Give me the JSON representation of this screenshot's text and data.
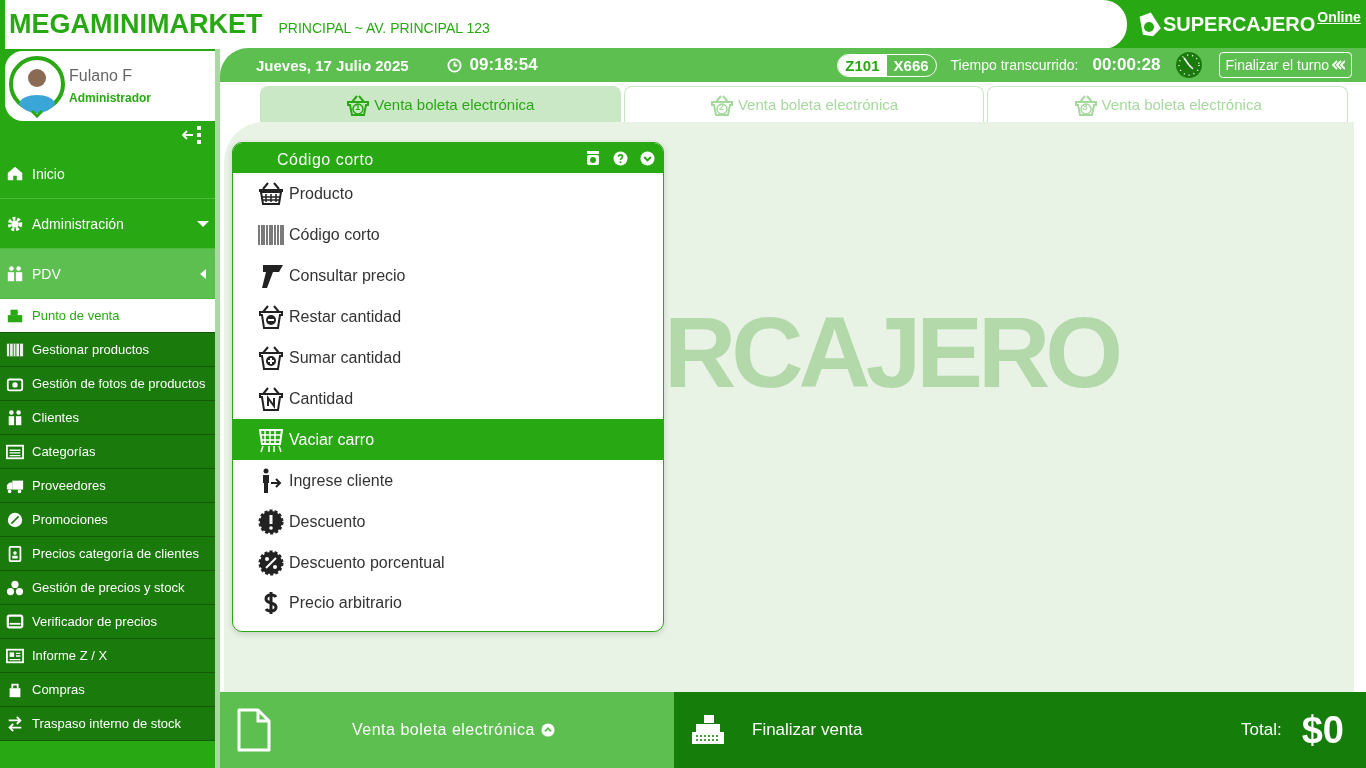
{
  "header": {
    "store_name": "MEGAMINIMARKET",
    "branch": "PRINCIPAL ~ AV. PRINCIPAL 123",
    "brand": "SUPERCAJERO",
    "brand_suffix": "Online"
  },
  "user": {
    "name": "Fulano F",
    "role": "Administrador"
  },
  "info_bar": {
    "date": "Jueves, 17 Julio 2025",
    "time": "09:18:54",
    "box_codes": [
      {
        "label": "Z101",
        "selected": true
      },
      {
        "label": "X666",
        "selected": false
      }
    ],
    "elapsed_label": "Tiempo transcurrido:",
    "elapsed": "00:00:28",
    "end_shift_button": "Finalizar el turno"
  },
  "tabs": [
    {
      "label": "Venta boleta electrónica",
      "badge": "1",
      "selected": true
    },
    {
      "label": "Venta boleta electrónica",
      "badge": "2",
      "selected": false
    },
    {
      "label": "Venta boleta electrónica",
      "badge": "3",
      "selected": false
    }
  ],
  "sidebar": {
    "items": [
      {
        "label": "Inicio",
        "expanded": false,
        "has_caret": false
      },
      {
        "label": "Administración",
        "expanded": false,
        "has_caret": true
      },
      {
        "label": "PDV",
        "expanded": true,
        "has_caret": true,
        "children": [
          {
            "label": "Punto de venta",
            "selected": true
          },
          {
            "label": "Gestionar productos",
            "selected": false
          },
          {
            "label": "Gestión de fotos de productos",
            "selected": false
          },
          {
            "label": "Clientes",
            "selected": false
          },
          {
            "label": "Categorías",
            "selected": false
          },
          {
            "label": "Proveedores",
            "selected": false
          },
          {
            "label": "Promociones",
            "selected": false
          },
          {
            "label": "Precios categoría de clientes",
            "selected": false
          },
          {
            "label": "Gestión de precios y stock",
            "selected": false
          },
          {
            "label": "Verificador de precios",
            "selected": false
          },
          {
            "label": "Informe Z / X",
            "selected": false
          },
          {
            "label": "Compras",
            "selected": false
          },
          {
            "label": "Traspaso interno de stock",
            "selected": false
          }
        ]
      }
    ]
  },
  "watermark": "RCAJERO",
  "input_mode_menu": {
    "title": "Código corto",
    "items": [
      {
        "label": "Producto",
        "selected": false
      },
      {
        "label": "Código corto",
        "selected": false
      },
      {
        "label": "Consultar precio",
        "selected": false
      },
      {
        "label": "Restar cantidad",
        "selected": false
      },
      {
        "label": "Sumar cantidad",
        "selected": false
      },
      {
        "label": "Cantidad",
        "selected": false
      },
      {
        "label": "Vaciar carro",
        "selected": true
      },
      {
        "label": "Ingrese cliente",
        "selected": false
      },
      {
        "label": "Descuento",
        "selected": false
      },
      {
        "label": "Descuento porcentual",
        "selected": false
      },
      {
        "label": "Precio arbitrario",
        "selected": false
      }
    ]
  },
  "bottom_bar": {
    "document_type": "Venta boleta electrónica",
    "finish_button": "Finalizar venta",
    "total_label": "Total:",
    "total": "$0"
  }
}
